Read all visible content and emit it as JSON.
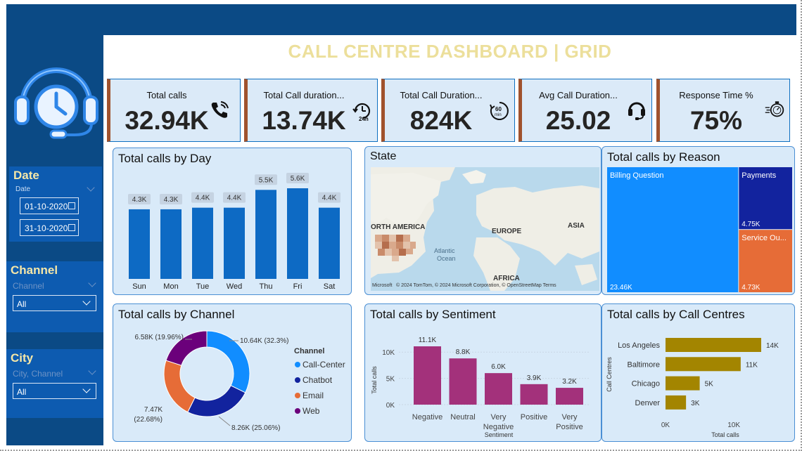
{
  "header": {
    "title": "CALL CENTRE DASHBOARD | GRID"
  },
  "sidebar": {
    "date": {
      "title": "Date",
      "sub": "Date",
      "start": "01-10-2020",
      "end": "31-10-2020"
    },
    "channel": {
      "title": "Channel",
      "sub": "Channel",
      "value": "All"
    },
    "city": {
      "title": "City",
      "sub": "City, Channel",
      "value": "All"
    }
  },
  "kpis": [
    {
      "label": "Total calls",
      "value": "32.94K",
      "icon": "phone-icon"
    },
    {
      "label": "Total Call duration...",
      "value": "13.74K",
      "icon": "24h-clock-icon"
    },
    {
      "label": "Total Call Duration...",
      "value": "824K",
      "icon": "60-min-icon"
    },
    {
      "label": "Avg Call Duration...",
      "value": "25.02",
      "icon": "headset-icon"
    },
    {
      "label": "Response Time %",
      "value": "75%",
      "icon": "stopwatch-icon"
    }
  ],
  "charts": {
    "day": {
      "title": "Total calls by Day"
    },
    "map": {
      "title": "State",
      "labels": {
        "na": "ORTH AMERICA",
        "eu": "EUROPE",
        "asia": "ASIA",
        "af": "AFRICA",
        "ocean1": "Atlantic",
        "ocean2": "Ocean"
      },
      "credit": "© 2024 TomTom, © 2024 Microsoft Corporation, © OpenStreetMap  Terms",
      "ms": "Microsoft"
    },
    "reason": {
      "title": "Total calls by Reason"
    },
    "channel": {
      "title": "Total calls by Channel",
      "legend_title": "Channel"
    },
    "sentiment": {
      "title": "Total calls by Sentiment"
    },
    "centres": {
      "title": "Total calls by Call Centres"
    }
  },
  "colors": {
    "accent_blue": "#0d6ac4",
    "magenta": "#a3317b",
    "olive": "#a38500",
    "header_bg": "#0b4a85"
  },
  "chart_data": [
    {
      "type": "bar",
      "title": "Total calls by Day",
      "categories": [
        "Sun",
        "Mon",
        "Tue",
        "Wed",
        "Thu",
        "Fri",
        "Sat"
      ],
      "values": [
        4300,
        4300,
        4400,
        4400,
        5500,
        5600,
        4400
      ],
      "labels": [
        "4.3K",
        "4.3K",
        "4.4K",
        "4.4K",
        "5.5K",
        "5.6K",
        "4.4K"
      ],
      "ylim": [
        0,
        5600
      ]
    },
    {
      "type": "treemap",
      "title": "Total calls by Reason",
      "items": [
        {
          "name": "Billing Question",
          "value": 23460,
          "label": "23.46K",
          "color": "#118dff"
        },
        {
          "name": "Payments",
          "value": 4750,
          "label": "4.75K",
          "color": "#12239e"
        },
        {
          "name": "Service Ou...",
          "value": 4730,
          "label": "4.73K",
          "color": "#e66c37"
        }
      ]
    },
    {
      "type": "pie",
      "title": "Total calls by Channel",
      "series": [
        {
          "name": "Call-Center",
          "value": 10640,
          "label": "10.64K (32.3%)",
          "color": "#118dff"
        },
        {
          "name": "Chatbot",
          "value": 8260,
          "label": "8.26K (25.06%)",
          "color": "#12239e"
        },
        {
          "name": "Email",
          "value": 7470,
          "label": "7.47K",
          "label2": "(22.68%)",
          "color": "#e66c37"
        },
        {
          "name": "Web",
          "value": 6580,
          "label": "6.58K (19.96%)",
          "color": "#6b007b"
        }
      ]
    },
    {
      "type": "bar",
      "title": "Total calls by Sentiment",
      "categories": [
        [
          "Negative"
        ],
        [
          "Neutral"
        ],
        [
          "Very",
          "Negative"
        ],
        [
          "Positive"
        ],
        [
          "Very",
          "Positive"
        ]
      ],
      "values": [
        11100,
        8800,
        6000,
        3900,
        3200
      ],
      "labels": [
        "11.1K",
        "8.8K",
        "6.0K",
        "3.9K",
        "3.2K"
      ],
      "xlabel": "Sentiment",
      "ylabel": "Total calls",
      "yticks": [
        "0K",
        "5K",
        "10K"
      ],
      "ytick_values": [
        0,
        5000,
        10000
      ],
      "ylim": [
        0,
        11100
      ]
    },
    {
      "type": "bar",
      "orientation": "horizontal",
      "title": "Total calls by Call Centres",
      "categories": [
        "Los Angeles",
        "Baltimore",
        "Chicago",
        "Denver"
      ],
      "values": [
        14000,
        11000,
        5000,
        3000
      ],
      "labels": [
        "14K",
        "11K",
        "5K",
        "3K"
      ],
      "xlabel": "Total calls",
      "ylabel": "Call Centres",
      "xticks": [
        "0K",
        "10K"
      ],
      "xtick_values": [
        0,
        10000
      ],
      "xlim": [
        0,
        14000
      ]
    }
  ]
}
